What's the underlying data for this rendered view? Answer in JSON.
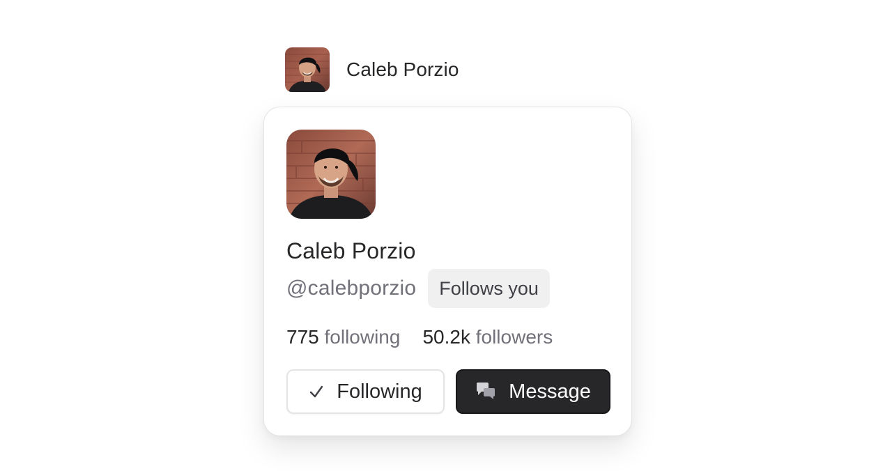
{
  "trigger": {
    "name": "Caleb Porzio",
    "avatar_icon": "person-photo-icon"
  },
  "card": {
    "avatar_icon": "person-photo-icon",
    "name": "Caleb Porzio",
    "handle": "@calebporzio",
    "badge": "Follows you",
    "stats": [
      {
        "value": "775",
        "label": "following"
      },
      {
        "value": "50.2k",
        "label": "followers"
      }
    ],
    "actions": {
      "following_label": "Following",
      "following_icon": "check-icon",
      "message_label": "Message",
      "message_icon": "chat-bubbles-icon"
    }
  },
  "colors": {
    "text": "#27272a",
    "muted": "#71717a",
    "badge_bg": "#f0f0f1",
    "primary_button": "#27272a",
    "border": "#e4e4e7"
  }
}
